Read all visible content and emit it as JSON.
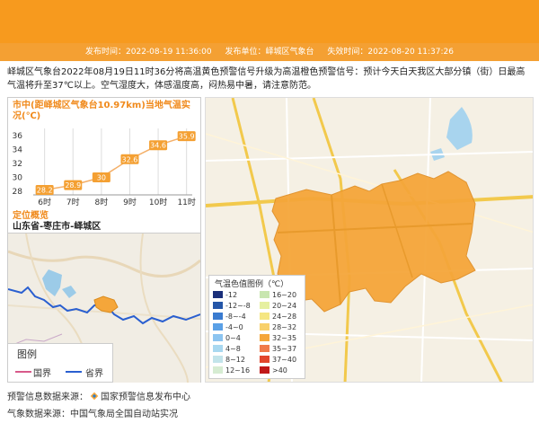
{
  "header": {
    "publish_time": "发布时间：2022-08-19 11:36:00",
    "publisher": "发布单位：峄城区气象台",
    "expire_time": "失效时间：2022-08-20 11:37:26"
  },
  "description": "峄城区气象台2022年08月19日11时36分将高温黄色预警信号升级为高温橙色预警信号：预计今天白天我区大部分镇（街）日最高气温将升至37℃以上。空气湿度大，体感温度高，闷热易中暑，请注意防范。",
  "chart_title": "市中(距峄城区气象台10.97km)当地气温实况(℃)",
  "chart_data": {
    "type": "line",
    "categories": [
      "6时",
      "7时",
      "8时",
      "9时",
      "10时",
      "11时"
    ],
    "values": [
      28.2,
      28.9,
      30,
      32.6,
      34.6,
      35.9
    ],
    "y_ticks": [
      "36",
      "34",
      "32",
      "30",
      "28"
    ],
    "ylim": [
      27.5,
      37
    ],
    "grid": "vertical",
    "line_color": "#f4b06a",
    "label_color": "#f4a033"
  },
  "location": {
    "title": "定位概览",
    "name": "山东省-枣庄市-峄城区"
  },
  "mini_legend": {
    "title": "图例",
    "national_border": "国界",
    "provincial_border": "省界"
  },
  "temp_legend": {
    "title": "气温色值图例（℃）",
    "items": [
      {
        "label": "-12",
        "color": "#1a2f7a"
      },
      {
        "label": "16~20",
        "color": "#c8e6b0"
      },
      {
        "label": "-12~-8",
        "color": "#2456a8"
      },
      {
        "label": "20~24",
        "color": "#e6f0a0"
      },
      {
        "label": "-8~-4",
        "color": "#3a7bd0"
      },
      {
        "label": "24~28",
        "color": "#f5e682"
      },
      {
        "label": "-4~0",
        "color": "#5aa0e6"
      },
      {
        "label": "28~32",
        "color": "#f8d06a"
      },
      {
        "label": "0~4",
        "color": "#8cc4f0"
      },
      {
        "label": "32~35",
        "color": "#f5a63a"
      },
      {
        "label": "4~8",
        "color": "#a8d8f0"
      },
      {
        "label": "35~37",
        "color": "#f07a4a"
      },
      {
        "label": "8~12",
        "color": "#c2e4ea"
      },
      {
        "label": "37~40",
        "color": "#e2452c"
      },
      {
        "label": "12~16",
        "color": "#d6ecd2"
      },
      {
        "label": ">40",
        "color": "#c01818"
      }
    ]
  },
  "footer": {
    "warning_source": "预警信息数据来源：",
    "warning_source_name": "国家预警信息发布中心",
    "weather_source": "气象数据来源：中国气象局全国自动站实况"
  },
  "colors": {
    "banner": "#f79a1e",
    "accent": "#f08a1c",
    "warning_area": "#f5a63a"
  }
}
